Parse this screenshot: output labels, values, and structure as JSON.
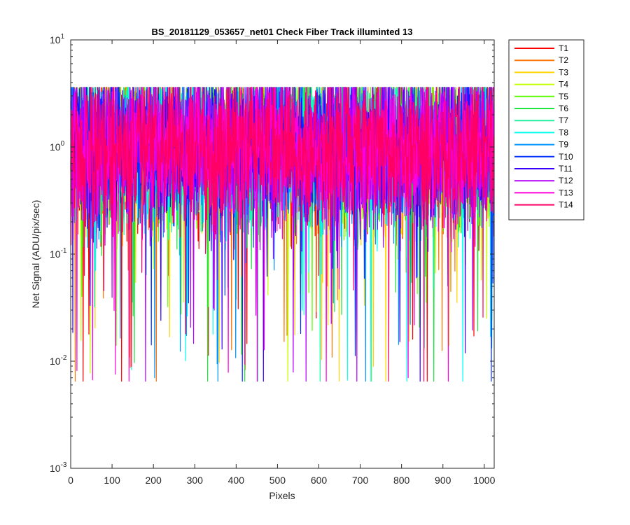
{
  "chart_data": {
    "type": "line",
    "title": "BS_20181129_053657_net01   Check Fiber     Track illuminted 13",
    "xlabel": "Pixels",
    "ylabel": "Net Signal (ADU/pix/sec)",
    "xlim": [
      0,
      1024
    ],
    "ylim": [
      0.001,
      10
    ],
    "yscale": "log",
    "grid": false,
    "legend_position": "outside-right",
    "x_ticks": [
      0,
      100,
      200,
      300,
      400,
      500,
      600,
      700,
      800,
      900,
      1000
    ],
    "y_ticks": [
      {
        "value": 0.001,
        "base": "10",
        "exp": "-3"
      },
      {
        "value": 0.01,
        "base": "10",
        "exp": "-2"
      },
      {
        "value": 0.1,
        "base": "10",
        "exp": "-1"
      },
      {
        "value": 1,
        "base": "10",
        "exp": "0"
      },
      {
        "value": 10,
        "base": "10",
        "exp": "1"
      }
    ],
    "series": [
      {
        "name": "T1",
        "color": "#ff0000"
      },
      {
        "name": "T2",
        "color": "#ff7300"
      },
      {
        "name": "T3",
        "color": "#ffd400"
      },
      {
        "name": "T4",
        "color": "#c4ff00"
      },
      {
        "name": "T5",
        "color": "#5cff00"
      },
      {
        "name": "T6",
        "color": "#1ee63c"
      },
      {
        "name": "T7",
        "color": "#22f0a0"
      },
      {
        "name": "T8",
        "color": "#00fff0"
      },
      {
        "name": "T9",
        "color": "#0095ff"
      },
      {
        "name": "T10",
        "color": "#0030ff"
      },
      {
        "name": "T11",
        "color": "#3a00ff"
      },
      {
        "name": "T12",
        "color": "#b400ff"
      },
      {
        "name": "T13",
        "color": "#ff00dc"
      },
      {
        "name": "T14",
        "color": "#ff0064"
      }
    ],
    "noise_model": {
      "median": 1.0,
      "peak_max": 3.6,
      "dip_min": 0.0065,
      "n_points": 1024
    }
  }
}
